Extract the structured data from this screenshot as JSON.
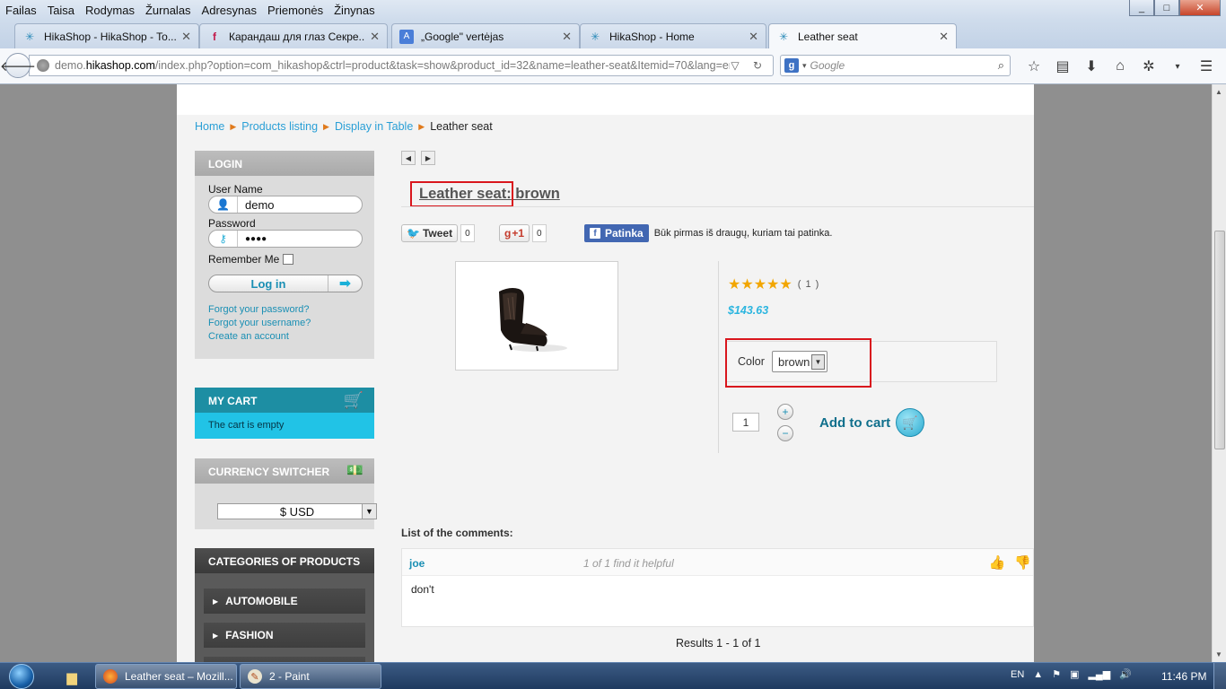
{
  "menu": [
    "Failas",
    "Taisa",
    "Rodymas",
    "Žurnalas",
    "Adresynas",
    "Priemonės",
    "Žinynas"
  ],
  "window_controls": [
    "_",
    "□",
    "✕"
  ],
  "tabs": [
    {
      "title": "HikaShop - HikaShop - To...",
      "icon": "hikashop-icon"
    },
    {
      "title": "Карандаш для глаз Секре...",
      "icon": "fl-icon"
    },
    {
      "title": "„Google\" vertėjas",
      "icon": "translate-icon"
    },
    {
      "title": "HikaShop - Home",
      "icon": "hikashop-icon"
    },
    {
      "title": "Leather seat",
      "icon": "hikashop-icon",
      "active": true
    }
  ],
  "url": {
    "pre": "demo.",
    "domain": "hikashop.com",
    "rest": "/index.php?option=com_hikashop&ctrl=product&task=show&product_id=32&name=leather-seat&Itemid=70&lang=en"
  },
  "search": {
    "placeholder": "Google"
  },
  "breadcrumb": {
    "home": "Home",
    "listing": "Products listing",
    "table": "Display in Table",
    "current": "Leather seat"
  },
  "login": {
    "title": "LOGIN",
    "username_label": "User Name",
    "username_value": "demo",
    "password_label": "Password",
    "password_value": "●●●●",
    "remember_label": "Remember Me",
    "button": "Log in",
    "forgot_password": "Forgot your password?",
    "forgot_username": "Forgot your username?",
    "create_account": "Create an account"
  },
  "cart": {
    "title": "MY CART",
    "empty": "The cart is empty"
  },
  "currency": {
    "title": "CURRENCY SWITCHER",
    "selected": "$ USD"
  },
  "categories": {
    "title": "CATEGORIES OF PRODUCTS",
    "items": [
      "AUTOMOBILE",
      "FASHION"
    ]
  },
  "product": {
    "title_main": "Leather seat:",
    "title_variant": " brown",
    "rating_count": "( 1 )",
    "price": "$143.63",
    "color_label": "Color",
    "color_value": "brown",
    "quantity": "1",
    "add_to_cart": "Add to cart"
  },
  "social": {
    "tweet": "Tweet",
    "tweet_count": "0",
    "gplus": "+1",
    "gplus_count": "0",
    "fb": "Patinka",
    "fb_text": "Būk pirmas iš draugų, kuriam tai patinka."
  },
  "comments": {
    "header": "List of the comments:",
    "items": [
      {
        "user": "joe",
        "helpful": "1 of 1 find it helpful",
        "text": "don't"
      }
    ],
    "results": "Results 1 - 1 of 1"
  },
  "taskbar": {
    "tasks": [
      "Leather seat – Mozill...",
      "2 - Paint"
    ],
    "lang": "EN",
    "time": "11:46 PM"
  },
  "colors": {
    "accent": "#2a9fd6",
    "highlight_box": "#d9161d",
    "cart_bg": "#21c3e6"
  }
}
